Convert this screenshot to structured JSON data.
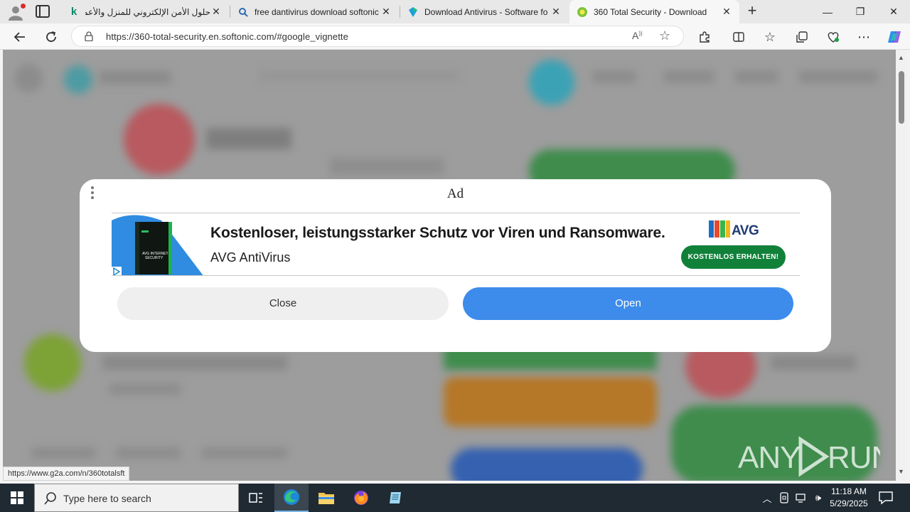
{
  "browser": {
    "tabs": [
      {
        "title": "حلول الأمن الإلكتروني للمنزل والأعمال",
        "favicon": "kaspersky-k-icon",
        "active": false
      },
      {
        "title": "free dantivirus download softonic",
        "favicon": "search-icon",
        "active": false
      },
      {
        "title": "Download Antivirus - Software fo",
        "favicon": "softonic-icon",
        "active": false
      },
      {
        "title": "360 Total Security - Download",
        "favicon": "360-icon",
        "active": true
      }
    ],
    "new_tab_label": "+",
    "window_controls": {
      "minimize": "—",
      "restore": "❐",
      "close": "✕"
    },
    "address": {
      "url": "https://360-total-security.en.softonic.com/#google_vignette"
    },
    "status_url": "https://www.g2a.com/n/360totalsft"
  },
  "ad_modal": {
    "label": "Ad",
    "banner": {
      "headline": "Kostenloser, leistungsstarker Schutz vor Viren und Ransomware.",
      "advertiser": "AVG AntiVirus",
      "brand": "AVG",
      "cta": "KOSTENLOS ERHALTEN!",
      "box_text": "AVG INTERNET SECURITY"
    },
    "close_label": "Close",
    "open_label": "Open",
    "colors": {
      "open_button": "#3d8ceb",
      "cta": "#11813a"
    }
  },
  "watermark": "ANY RUN",
  "taskbar": {
    "search_placeholder": "Type here to search",
    "apps": [
      "task-view-icon",
      "edge-icon",
      "file-explorer-icon",
      "firefox-icon",
      "notepad-icon"
    ],
    "clock": {
      "time": "11:18 AM",
      "date": "5/29/2025"
    }
  }
}
